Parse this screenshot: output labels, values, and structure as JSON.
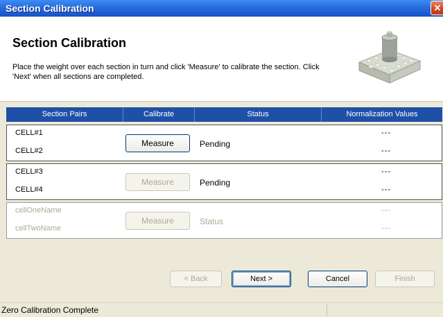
{
  "window": {
    "title": "Section Calibration",
    "close_glyph": "✕"
  },
  "header": {
    "heading": "Section Calibration",
    "instructions": "Place the weight over each section in turn and click 'Measure' to calibrate the section. Click 'Next' when all sections are completed.",
    "image_icon": "calibration-weight-icon"
  },
  "table": {
    "columns": [
      "Section Pairs",
      "Calibrate",
      "Status",
      "Normalization Values"
    ],
    "rows": [
      {
        "cell_a": "CELL#1",
        "cell_b": "CELL#2",
        "button": "Measure",
        "status": "Pending",
        "norm_a": "---",
        "norm_b": "---"
      },
      {
        "cell_a": "CELL#3",
        "cell_b": "CELL#4",
        "button": "Measure",
        "status": "Pending",
        "norm_a": "---",
        "norm_b": "---"
      },
      {
        "cell_a": "cellOneName",
        "cell_b": "cellTwoName",
        "button": "Measure",
        "status": "Status",
        "norm_a": "---",
        "norm_b": "---"
      }
    ]
  },
  "buttons": {
    "back": "< Back",
    "next": "Next >",
    "cancel": "Cancel",
    "finish": "Finish"
  },
  "statusbar": {
    "message": "Zero Calibration Complete"
  }
}
